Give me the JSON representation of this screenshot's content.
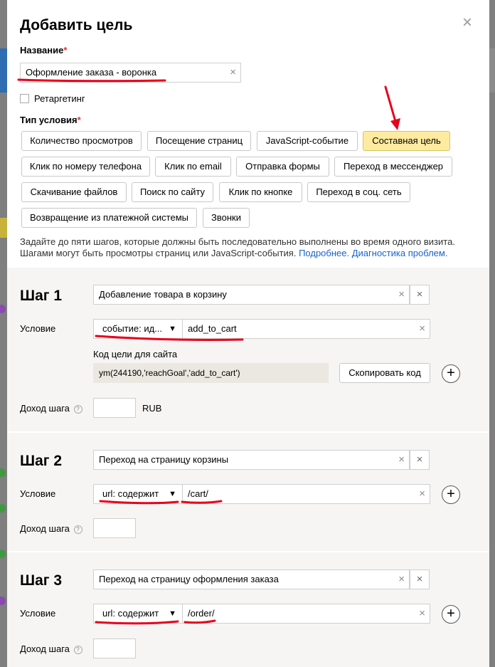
{
  "dialog": {
    "title": "Добавить цель",
    "close_glyph": "×",
    "name_label": "Название",
    "required_mark": "*",
    "name_value": "Оформление заказа - воронка",
    "retargeting_label": "Ретаргетинг",
    "condition_type_label": "Тип условия"
  },
  "condition_types": [
    "Количество просмотров",
    "Посещение страниц",
    "JavaScript-событие",
    "Составная цель",
    "Клик по номеру телефона",
    "Клик по email",
    "Отправка формы",
    "Переход в мессенджер",
    "Скачивание файлов",
    "Поиск по сайту",
    "Клик по кнопке",
    "Переход в соц. сеть",
    "Возвращение из платежной системы",
    "Звонки"
  ],
  "selected_condition_type": "Составная цель",
  "description": {
    "text": "Задайте до пяти шагов, которые должны быть последовательно выполнены во время одного визита. Шагами могут быть просмотры страниц или JavaScript-события.",
    "link_more": "Подробнее.",
    "link_diag": "Диагностика проблем."
  },
  "common": {
    "condition_label": "Условие",
    "income_label": "Доход шага",
    "help_glyph": "?",
    "clear_glyph": "×",
    "plus_glyph": "+",
    "chevron_glyph": "▼"
  },
  "steps": [
    {
      "title": "Шаг 1",
      "name": "Добавление товара в корзину",
      "condition_type": "событие: ид...",
      "condition_value": "add_to_cart",
      "code_label": "Код цели для сайта",
      "code": "ym(244190,'reachGoal','add_to_cart')",
      "copy_label": "Скопировать код",
      "currency": "RUB"
    },
    {
      "title": "Шаг 2",
      "name": "Переход на страницу корзины",
      "condition_type": "url: содержит",
      "condition_value": "/cart/"
    },
    {
      "title": "Шаг 3",
      "name": "Переход на страницу оформления заказа",
      "condition_type": "url: содержит",
      "condition_value": "/order/"
    }
  ],
  "colors": {
    "active_chip": "#ffeba0",
    "link": "#1a62c8",
    "annotation": "#e8001c",
    "step_bg": "#f6f5f3"
  }
}
